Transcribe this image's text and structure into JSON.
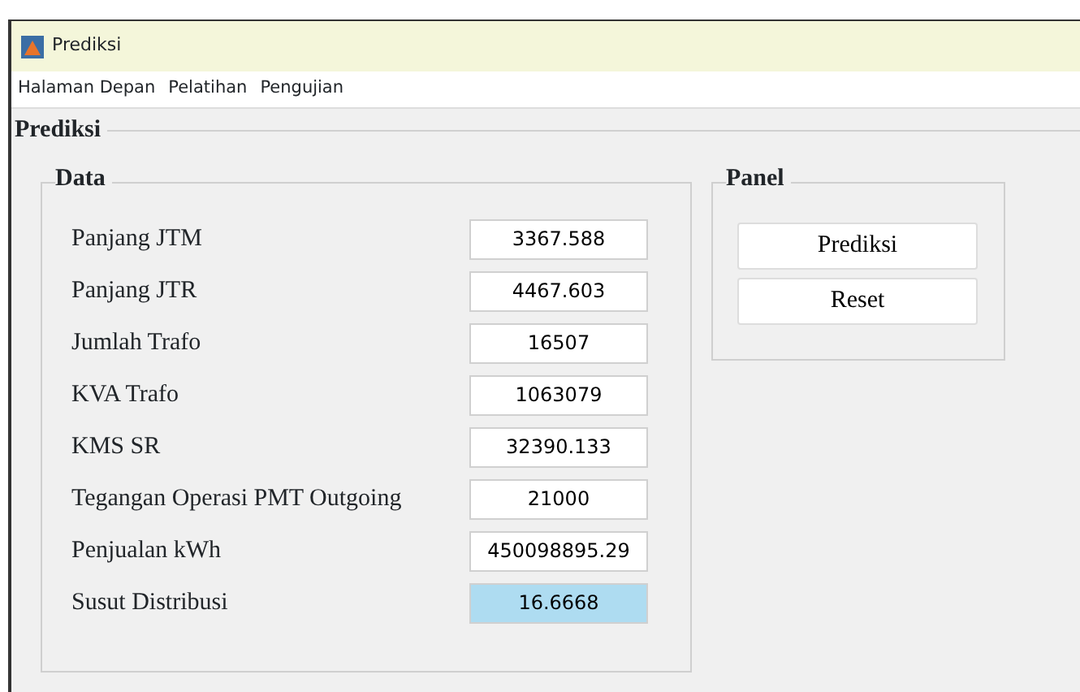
{
  "window": {
    "title": "Prediksi"
  },
  "menu": [
    "Halaman Depan",
    "Pelatihan",
    "Pengujian"
  ],
  "main_group": {
    "title": "Prediksi"
  },
  "data_panel": {
    "title": "Data",
    "fields": [
      {
        "label": "Panjang JTM",
        "value": "3367.588",
        "kind": "input"
      },
      {
        "label": "Panjang JTR",
        "value": "4467.603",
        "kind": "input"
      },
      {
        "label": "Jumlah Trafo",
        "value": "16507",
        "kind": "input"
      },
      {
        "label": "KVA Trafo",
        "value": "1063079",
        "kind": "input"
      },
      {
        "label": "KMS SR",
        "value": "32390.133",
        "kind": "input"
      },
      {
        "label": "Tegangan Operasi PMT Outgoing",
        "value": "21000",
        "kind": "input"
      },
      {
        "label": "Penjualan kWh",
        "value": "450098895.29",
        "kind": "input"
      },
      {
        "label": "Susut Distribusi",
        "value": "16.6668",
        "kind": "output"
      }
    ]
  },
  "control_panel": {
    "title": "Panel",
    "buttons": [
      "Prediksi",
      "Reset"
    ]
  }
}
